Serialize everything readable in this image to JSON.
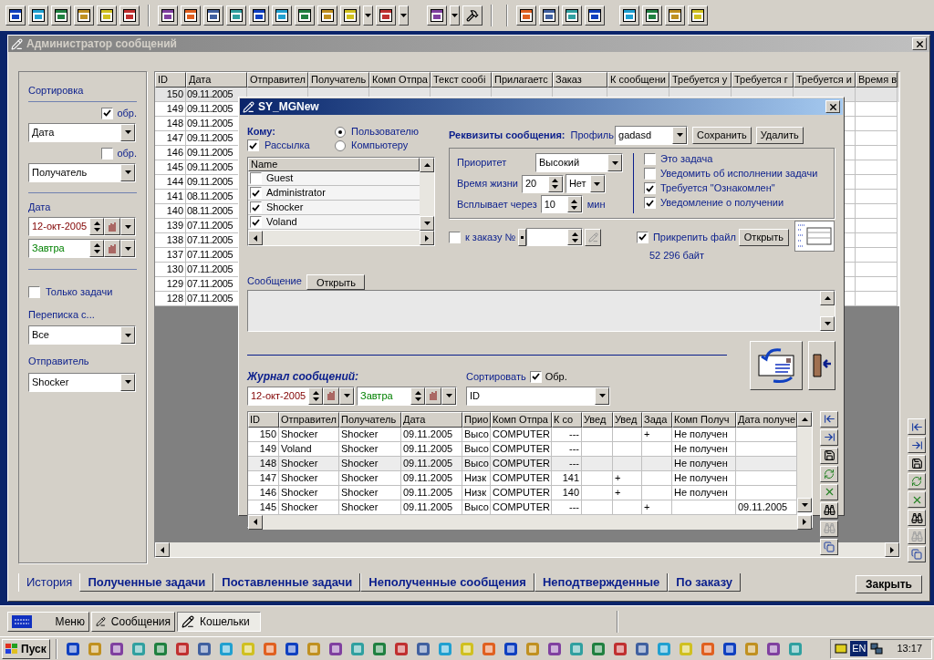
{
  "window": {
    "title": "Администратор сообщений"
  },
  "sidebar": {
    "sort_title": "Сортировка",
    "sorts": [
      {
        "reverse_label": "обр.",
        "checked": true,
        "field": "Дата"
      },
      {
        "reverse_label": "обр.",
        "checked": false,
        "field": "Получатель"
      }
    ],
    "date_title": "Дата",
    "date_from": "12-окт-2005",
    "date_to": "Завтра",
    "tasks_only": {
      "label": "Только задачи",
      "checked": false
    },
    "correspondence": {
      "label": "Переписка с...",
      "value": "Все"
    },
    "sender": {
      "label": "Отправитель",
      "value": "Shocker"
    }
  },
  "table": {
    "columns": [
      "ID",
      "Дата",
      "Отправител",
      "Получатель",
      "Комп Отпра",
      "Текст сообі",
      "Прилагаетс",
      "Заказ",
      "К сообщени",
      "Требуется у",
      "Требуется г",
      "Требуется и",
      "Время в"
    ],
    "rows": [
      {
        "id": "150",
        "date": "09.11.2005",
        "selected": true
      },
      {
        "id": "149",
        "date": "09.11.2005",
        "selected": false
      },
      {
        "id": "148",
        "date": "09.11.2005",
        "selected": false
      },
      {
        "id": "147",
        "date": "09.11.2005",
        "selected": false
      },
      {
        "id": "146",
        "date": "09.11.2005",
        "selected": false
      },
      {
        "id": "145",
        "date": "09.11.2005",
        "selected": false
      },
      {
        "id": "144",
        "date": "09.11.2005",
        "selected": false
      },
      {
        "id": "141",
        "date": "08.11.2005",
        "selected": false
      },
      {
        "id": "140",
        "date": "08.11.2005",
        "selected": false
      },
      {
        "id": "139",
        "date": "07.11.2005",
        "selected": false
      },
      {
        "id": "138",
        "date": "07.11.2005",
        "selected": false
      },
      {
        "id": "137",
        "date": "07.11.2005",
        "selected": false
      },
      {
        "id": "130",
        "date": "07.11.2005",
        "selected": false
      },
      {
        "id": "129",
        "date": "07.11.2005",
        "selected": false
      },
      {
        "id": "128",
        "date": "07.11.2005",
        "selected": false
      }
    ]
  },
  "dialog": {
    "title": "SY_MGNew",
    "to_label": "Кому:",
    "target": [
      {
        "label": "Пользователю",
        "selected": true
      },
      {
        "label": "Компьютеру",
        "selected": false
      }
    ],
    "broadcast": {
      "label": "Рассылка",
      "checked": true
    },
    "users": {
      "header": "Name",
      "items": [
        {
          "name": "Guest",
          "checked": false
        },
        {
          "name": "Administrator",
          "checked": true
        },
        {
          "name": "Shocker",
          "checked": true
        },
        {
          "name": "Voland",
          "checked": true
        }
      ]
    },
    "details_title": "Реквизиты сообщения:",
    "profile_label": "Профиль",
    "profile": "gadasd",
    "save_button": "Сохранить",
    "delete_button": "Удалить",
    "priority_label": "Приоритет",
    "priority": "Высокий",
    "lifetime_label": "Время жизни",
    "lifetime": "20",
    "lifetime_unit": "Нет",
    "popup_label": "Всплывает через",
    "popup": "10",
    "popup_unit": "мин",
    "options": [
      {
        "label": "Это задача",
        "checked": false
      },
      {
        "label": "Уведомить об исполнении задачи",
        "checked": false
      },
      {
        "label": "Требуется \"Ознакомлен\"",
        "checked": true
      },
      {
        "label": "Уведомление о получении",
        "checked": true
      }
    ],
    "order": {
      "label": "к заказу №",
      "checked": false
    },
    "attach": {
      "label": "Прикрепить файл",
      "checked": true,
      "button": "Открыть",
      "size": "52 296 байт"
    },
    "message_label": "Сообщение",
    "message_button": "Открыть",
    "journal": {
      "title": "Журнал сообщений:",
      "date_from": "12-окт-2005",
      "date_to": "Завтра",
      "sort_label": "Сортировать",
      "reverse": {
        "label": "Обр.",
        "checked": true
      },
      "sort_field": "ID",
      "columns": [
        "ID",
        "Отправител",
        "Получатель",
        "Дата",
        "Прио",
        "Комп Отпра",
        "К со",
        "Увед",
        "Увед",
        "Зада",
        "Комп Получ",
        "Дата получе"
      ],
      "rows": [
        {
          "id": "150",
          "sender": "Shocker",
          "recipient": "Shocker",
          "date": "09.11.2005",
          "priority": "Высо",
          "computer": "COMPUTER",
          "reply_to": "---",
          "task": "+",
          "recipient_computer": "Не получен",
          "selected": false
        },
        {
          "id": "149",
          "sender": "Voland",
          "recipient": "Shocker",
          "date": "09.11.2005",
          "priority": "Высо",
          "computer": "COMPUTER",
          "reply_to": "---",
          "recipient_computer": "Не получен",
          "selected": false
        },
        {
          "id": "148",
          "sender": "Shocker",
          "recipient": "Shocker",
          "date": "09.11.2005",
          "priority": "Высо",
          "computer": "COMPUTER",
          "reply_to": "---",
          "recipient_computer": "Не получен",
          "selected": true
        },
        {
          "id": "147",
          "sender": "Shocker",
          "recipient": "Shocker",
          "date": "09.11.2005",
          "priority": "Низк",
          "computer": "COMPUTER",
          "reply_to": "141",
          "notify_b": "+",
          "recipient_computer": "Не получен",
          "selected": false
        },
        {
          "id": "146",
          "sender": "Shocker",
          "recipient": "Shocker",
          "date": "09.11.2005",
          "priority": "Низк",
          "computer": "COMPUTER",
          "reply_to": "140",
          "notify_b": "+",
          "recipient_computer": "Не получен",
          "selected": false
        },
        {
          "id": "145",
          "sender": "Shocker",
          "recipient": "Shocker",
          "date": "09.11.2005",
          "priority": "Высо",
          "computer": "COMPUTER",
          "reply_to": "---",
          "task": "+",
          "received_date": "09.11.2005",
          "selected": false
        }
      ]
    }
  },
  "tabs": [
    {
      "label": "История",
      "selected": true
    },
    {
      "label": "Полученные задачи",
      "selected": false
    },
    {
      "label": "Поставленные задачи",
      "selected": false
    },
    {
      "label": "Неполученные сообщения",
      "selected": false
    },
    {
      "label": "Неподтвержденные",
      "selected": false
    },
    {
      "label": "По заказу",
      "selected": false
    }
  ],
  "close_button": "Закрыть",
  "app_bar": [
    {
      "label": "Меню",
      "selected": false
    },
    {
      "label": "Сообщения",
      "selected": false
    },
    {
      "label": "Кошельки",
      "selected": true
    }
  ],
  "taskbar": {
    "start": "Пуск",
    "language": "EN",
    "clock": "13:17"
  }
}
